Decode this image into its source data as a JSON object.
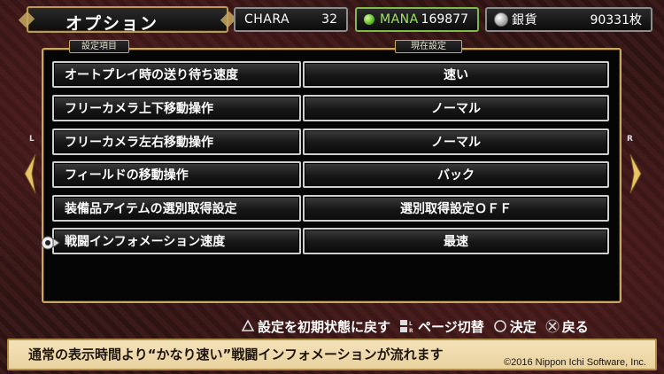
{
  "header": {
    "title": "オプション",
    "chara_label": "CHARA",
    "chara_value": "32",
    "mana_label": "MANA",
    "mana_value": "169877",
    "silver_label": "銀貨",
    "silver_value": "90331枚"
  },
  "columns": {
    "setting_item": "設定項目",
    "current_setting": "現在設定"
  },
  "options": [
    {
      "name": "オートプレイ時の送り待ち速度",
      "value": "速い"
    },
    {
      "name": "フリーカメラ上下移動操作",
      "value": "ノーマル"
    },
    {
      "name": "フリーカメラ左右移動操作",
      "value": "ノーマル"
    },
    {
      "name": "フィールドの移動操作",
      "value": "バック"
    },
    {
      "name": "装備品アイテムの選別取得設定",
      "value": "選別取得設定ＯＦＦ"
    },
    {
      "name": "戦闘インフォメーション速度",
      "value": "最速"
    }
  ],
  "selected_index": 5,
  "page_nav": {
    "left": "L",
    "right": "R"
  },
  "hints": {
    "reset": "設定を初期状態に戻す",
    "page_switch": "ページ切替",
    "confirm": "決定",
    "back": "戻る"
  },
  "help": {
    "text": "通常の表示時間より“かなり速い”戦闘インフォメーションが流れます",
    "copyright": "©2016 Nippon Ichi Software, Inc."
  },
  "colors": {
    "gold": "#c9a862",
    "mana_green": "#7cbb4a",
    "help_bg": "#f4e2b8"
  }
}
